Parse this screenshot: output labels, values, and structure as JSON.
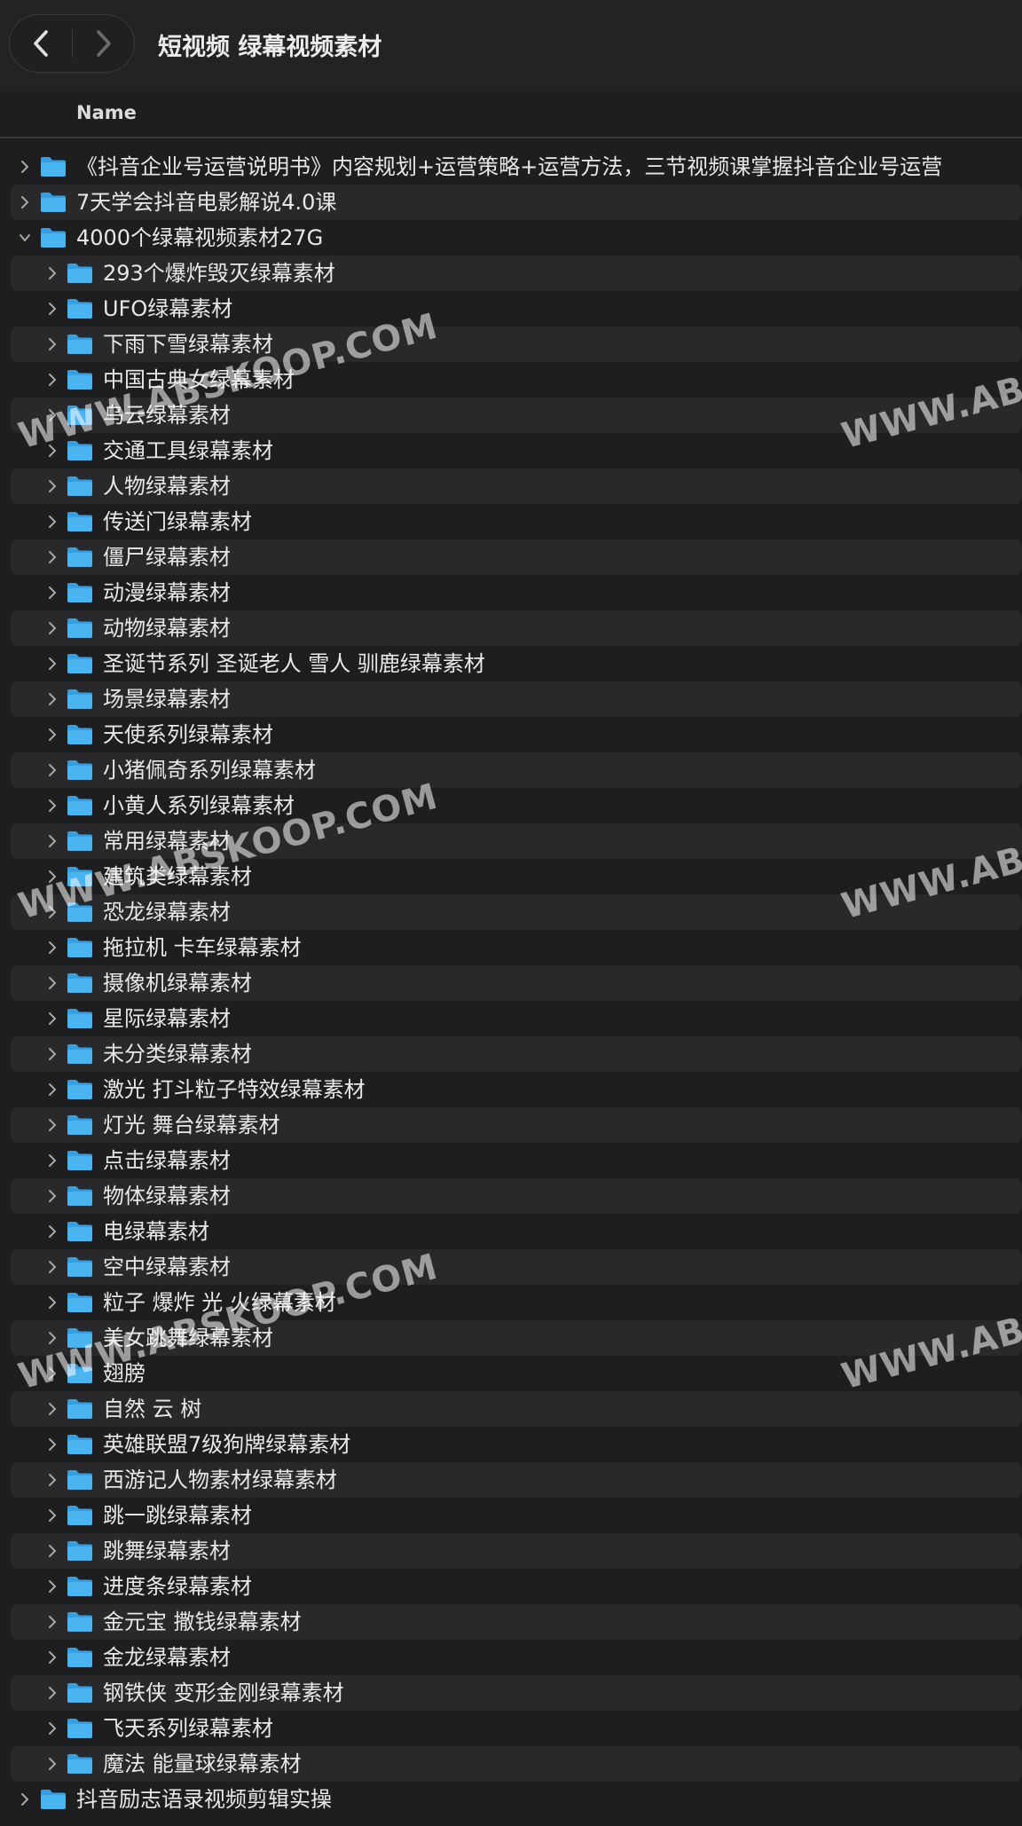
{
  "window": {
    "title": "短视频 绿幕视频素材",
    "nav": {
      "back_icon": "chevron-left-icon",
      "forward_icon": "chevron-right-icon"
    }
  },
  "columns": {
    "name": "Name"
  },
  "colors": {
    "folder": "#4ab4f0",
    "folder_tab": "#3a9ddc",
    "chevron": "#a8a8ac",
    "row_alt": "#29292c",
    "background": "#1e1e20"
  },
  "items": [
    {
      "name": "《抖音企业号运营说明书》内容规划+运营策略+运营方法，三节视频课掌握抖音企业号运营",
      "level": 0,
      "expanded": false
    },
    {
      "name": "7天学会抖音电影解说4.0课",
      "level": 0,
      "expanded": false
    },
    {
      "name": "4000个绿幕视频素材27G",
      "level": 0,
      "expanded": true
    },
    {
      "name": "293个爆炸毁灭绿幕素材",
      "level": 1,
      "expanded": false
    },
    {
      "name": "UFO绿幕素材",
      "level": 1,
      "expanded": false
    },
    {
      "name": "下雨下雪绿幕素材",
      "level": 1,
      "expanded": false
    },
    {
      "name": "中国古典女绿幕素材",
      "level": 1,
      "expanded": false
    },
    {
      "name": "乌云绿幕素材",
      "level": 1,
      "expanded": false
    },
    {
      "name": "交通工具绿幕素材",
      "level": 1,
      "expanded": false
    },
    {
      "name": "人物绿幕素材",
      "level": 1,
      "expanded": false
    },
    {
      "name": "传送门绿幕素材",
      "level": 1,
      "expanded": false
    },
    {
      "name": "僵尸绿幕素材",
      "level": 1,
      "expanded": false
    },
    {
      "name": "动漫绿幕素材",
      "level": 1,
      "expanded": false
    },
    {
      "name": "动物绿幕素材",
      "level": 1,
      "expanded": false
    },
    {
      "name": "圣诞节系列 圣诞老人 雪人 驯鹿绿幕素材",
      "level": 1,
      "expanded": false
    },
    {
      "name": "场景绿幕素材",
      "level": 1,
      "expanded": false
    },
    {
      "name": "天使系列绿幕素材",
      "level": 1,
      "expanded": false
    },
    {
      "name": "小猪佩奇系列绿幕素材",
      "level": 1,
      "expanded": false
    },
    {
      "name": "小黄人系列绿幕素材",
      "level": 1,
      "expanded": false
    },
    {
      "name": "常用绿幕素材",
      "level": 1,
      "expanded": false
    },
    {
      "name": "建筑类绿幕素材",
      "level": 1,
      "expanded": false
    },
    {
      "name": "恐龙绿幕素材",
      "level": 1,
      "expanded": false
    },
    {
      "name": "拖拉机 卡车绿幕素材",
      "level": 1,
      "expanded": false
    },
    {
      "name": "摄像机绿幕素材",
      "level": 1,
      "expanded": false
    },
    {
      "name": "星际绿幕素材",
      "level": 1,
      "expanded": false
    },
    {
      "name": "未分类绿幕素材",
      "level": 1,
      "expanded": false
    },
    {
      "name": "激光 打斗粒子特效绿幕素材",
      "level": 1,
      "expanded": false
    },
    {
      "name": "灯光 舞台绿幕素材",
      "level": 1,
      "expanded": false
    },
    {
      "name": "点击绿幕素材",
      "level": 1,
      "expanded": false
    },
    {
      "name": "物体绿幕素材",
      "level": 1,
      "expanded": false
    },
    {
      "name": "电绿幕素材",
      "level": 1,
      "expanded": false
    },
    {
      "name": "空中绿幕素材",
      "level": 1,
      "expanded": false
    },
    {
      "name": "粒子 爆炸 光 火绿幕素材",
      "level": 1,
      "expanded": false
    },
    {
      "name": "美女跳舞绿幕素材",
      "level": 1,
      "expanded": false
    },
    {
      "name": "翅膀",
      "level": 1,
      "expanded": false
    },
    {
      "name": "自然 云 树",
      "level": 1,
      "expanded": false
    },
    {
      "name": "英雄联盟7级狗牌绿幕素材",
      "level": 1,
      "expanded": false
    },
    {
      "name": "西游记人物素材绿幕素材",
      "level": 1,
      "expanded": false
    },
    {
      "name": "跳一跳绿幕素材",
      "level": 1,
      "expanded": false
    },
    {
      "name": "跳舞绿幕素材",
      "level": 1,
      "expanded": false
    },
    {
      "name": "进度条绿幕素材",
      "level": 1,
      "expanded": false
    },
    {
      "name": "金元宝 撒钱绿幕素材",
      "level": 1,
      "expanded": false
    },
    {
      "name": "金龙绿幕素材",
      "level": 1,
      "expanded": false
    },
    {
      "name": "钢铁侠 变形金刚绿幕素材",
      "level": 1,
      "expanded": false
    },
    {
      "name": "飞天系列绿幕素材",
      "level": 1,
      "expanded": false
    },
    {
      "name": "魔法 能量球绿幕素材",
      "level": 1,
      "expanded": false
    },
    {
      "name": "抖音励志语录视频剪辑实操",
      "level": 0,
      "expanded": false
    }
  ],
  "watermarks": [
    "WWW.ABSKOOP.COM",
    "WWW.ABS"
  ]
}
